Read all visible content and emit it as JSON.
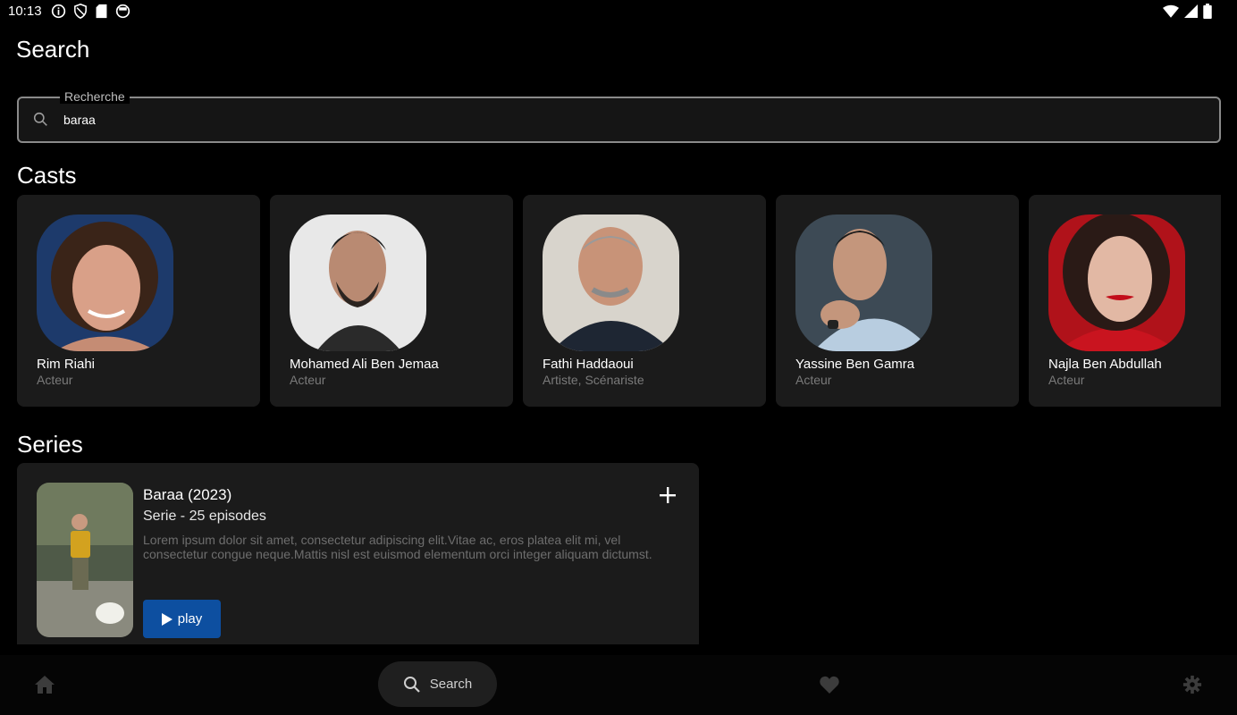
{
  "status_bar": {
    "time": "10:13",
    "left_icons": [
      "info-icon",
      "shield-icon",
      "sd-card-icon",
      "circle-app-icon"
    ],
    "right_icons": [
      "wifi-icon",
      "signal-icon",
      "battery-icon"
    ]
  },
  "page": {
    "title": "Search"
  },
  "search": {
    "label": "Recherche",
    "value": "baraa"
  },
  "casts": {
    "title": "Casts",
    "items": [
      {
        "name": "Rim Riahi",
        "role": "Acteur"
      },
      {
        "name": "Mohamed Ali Ben Jemaa",
        "role": "Acteur"
      },
      {
        "name": "Fathi Haddaoui",
        "role": "Artiste, Scénariste"
      },
      {
        "name": "Yassine Ben Gamra",
        "role": "Acteur"
      },
      {
        "name": "Najla Ben Abdullah",
        "role": "Acteur"
      }
    ]
  },
  "series": {
    "title": "Series",
    "items": [
      {
        "title": "Baraa (2023)",
        "meta": "Serie - 25 episodes",
        "description": "Lorem ipsum dolor sit amet, consectetur adipiscing elit.Vitae ac, eros platea elit mi, vel consectetur congue neque.Mattis nisl est euismod elementum orci integer aliquam dictumst.",
        "play_label": "play"
      }
    ]
  },
  "bottom_nav": {
    "items": [
      {
        "icon": "home-icon"
      },
      {
        "icon": "search-icon",
        "label": "Search",
        "active": true
      },
      {
        "icon": "heart-icon"
      },
      {
        "icon": "gear-icon"
      }
    ]
  },
  "colors": {
    "background": "#000000",
    "card": "#1b1b1b",
    "play_button": "#0d4fa0",
    "muted_text": "#7a7a7a"
  }
}
